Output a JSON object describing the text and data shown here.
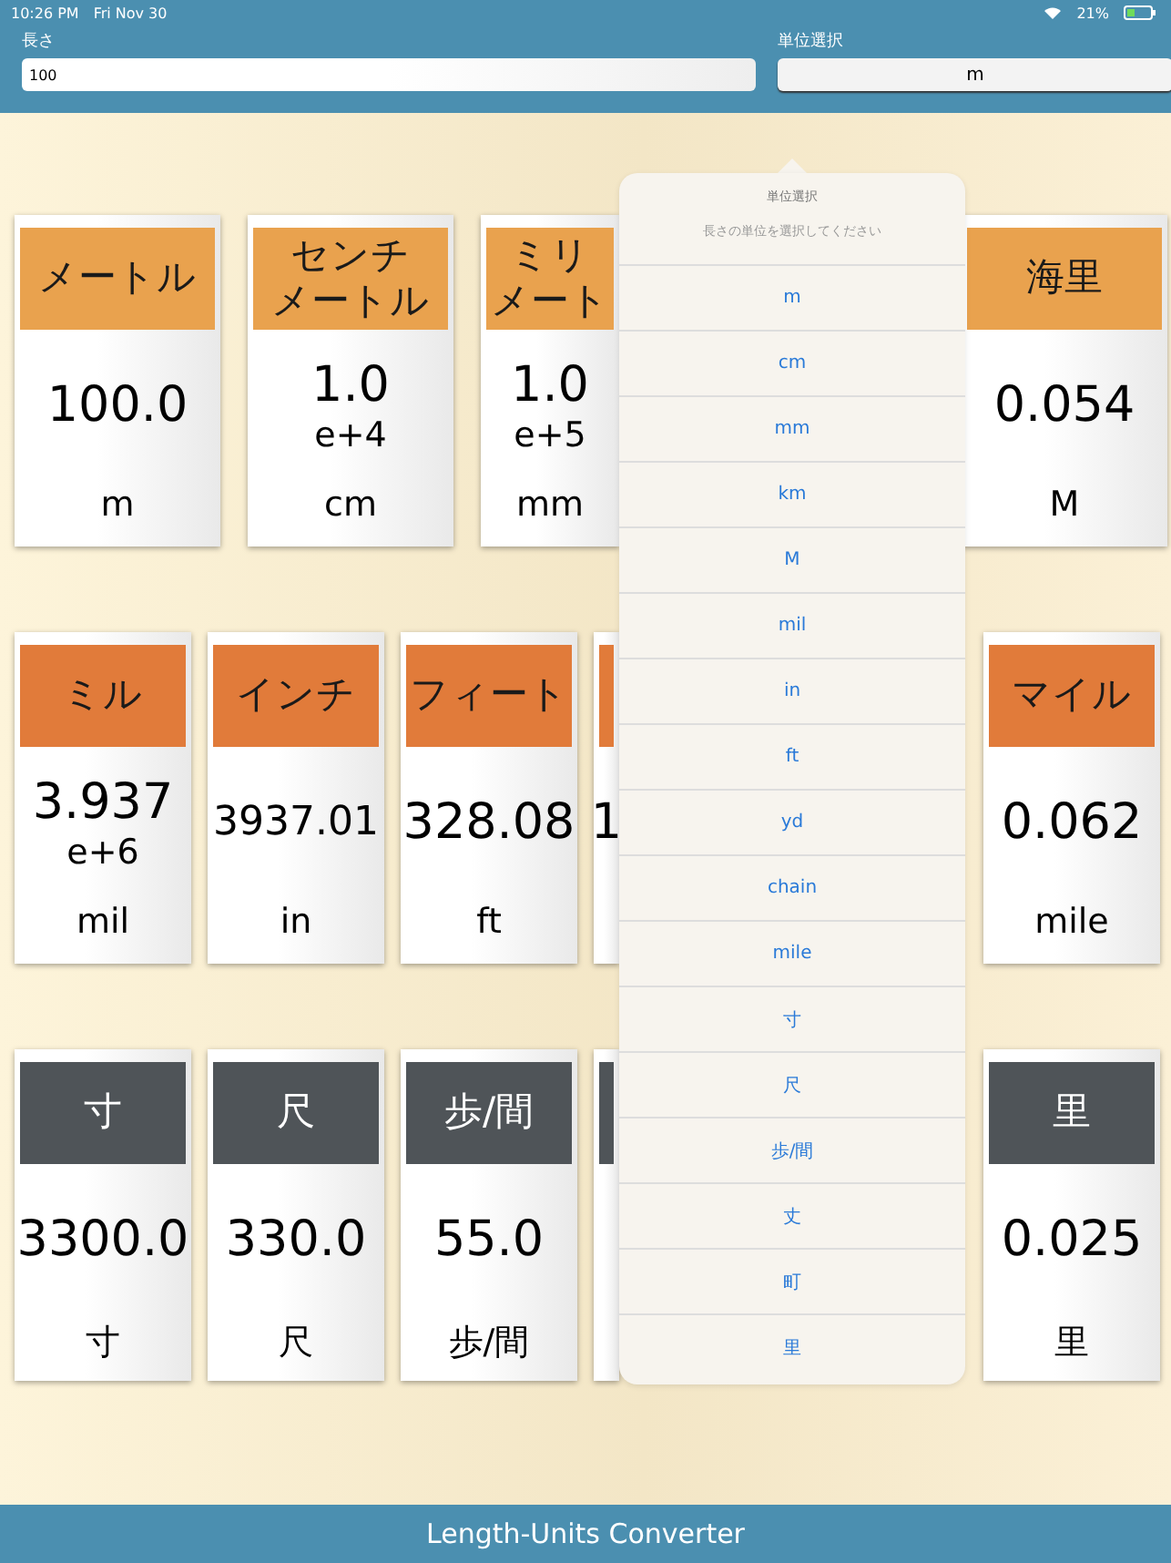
{
  "status_bar": {
    "time": "10:26 PM",
    "date": "Fri Nov 30",
    "battery": "21%"
  },
  "inputs": {
    "length_label": "長さ",
    "length_value": "100",
    "unit_label": "単位選択",
    "unit_value": "m"
  },
  "rows": [
    {
      "color": "#e9a24e",
      "cards": [
        {
          "kind": "full",
          "header": [
            "メートル"
          ],
          "value": "100.0",
          "unit": "m"
        },
        {
          "kind": "full",
          "header": [
            "センチ",
            "メートル"
          ],
          "value": "1.0",
          "exponent": "e+4",
          "unit": "cm"
        },
        {
          "kind": "partial",
          "header": [
            "ミリ",
            "メート"
          ],
          "value": "1.0",
          "exponent": "e+5",
          "unit": "mm"
        }
      ],
      "right_card": {
        "header": [
          "海里"
        ],
        "value": "0.054",
        "unit": "M"
      }
    },
    {
      "color": "#e17b3a",
      "cards": [
        {
          "kind": "full",
          "header": [
            "ミル"
          ],
          "value": "3.937",
          "exponent": "e+6",
          "unit": "mil"
        },
        {
          "kind": "full",
          "header": [
            "インチ"
          ],
          "value": "3937.01",
          "unit": "in"
        },
        {
          "kind": "full",
          "header": [
            "フィート"
          ],
          "value": "328.08",
          "unit": "ft"
        },
        {
          "kind": "partial",
          "value": "1"
        }
      ],
      "right_card": {
        "header": [
          "マイル"
        ],
        "value": "0.062",
        "unit": "mile"
      }
    },
    {
      "color": "#4f5458",
      "cards": [
        {
          "kind": "full",
          "header": [
            "寸"
          ],
          "value": "3300.0",
          "unit": "寸"
        },
        {
          "kind": "full",
          "header": [
            "尺"
          ],
          "value": "330.0",
          "unit": "尺"
        },
        {
          "kind": "full",
          "header": [
            "歩/間"
          ],
          "value": "55.0",
          "unit": "歩/間"
        },
        {
          "kind": "partial"
        }
      ],
      "right_card": {
        "header": [
          "里"
        ],
        "value": "0.025",
        "unit": "里"
      }
    }
  ],
  "popover": {
    "title": "単位選択",
    "message": "長さの単位を選択してください",
    "options": [
      "m",
      "cm",
      "mm",
      "km",
      "M",
      "mil",
      "in",
      "ft",
      "yd",
      "chain",
      "mile",
      "寸",
      "尺",
      "歩/間",
      "丈",
      "町",
      "里"
    ]
  },
  "footer": {
    "title": "Length-Units Converter"
  }
}
